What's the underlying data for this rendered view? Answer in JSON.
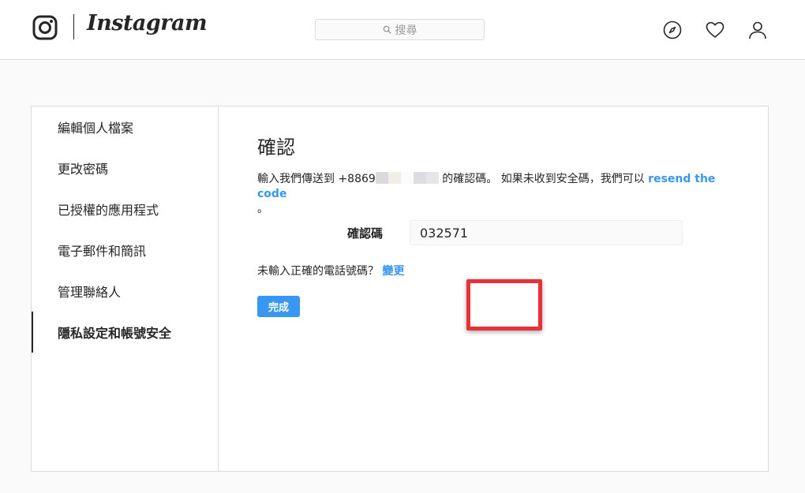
{
  "header": {
    "brand": "Instagram",
    "search_placeholder": "搜尋"
  },
  "sidebar": {
    "items": [
      {
        "label": "編輯個人檔案"
      },
      {
        "label": "更改密碼"
      },
      {
        "label": "已授權的應用程式"
      },
      {
        "label": "電子郵件和簡訊"
      },
      {
        "label": "管理聯絡人"
      },
      {
        "label": "隱私設定和帳號安全",
        "active": true
      }
    ]
  },
  "main": {
    "title": "確認",
    "info_prefix": "輸入我們傳送到 +8869",
    "info_middle": " 的確認碼。 如果未收到安全碼，我們可以 ",
    "resend_link": "resend the code",
    "info_suffix": "。",
    "code_label": "確認碼",
    "code_value": "032571",
    "wrong_number_text": "未輸入正確的電話號碼？ ",
    "change_link": "變更",
    "done_button": "完成"
  },
  "colors": {
    "accent": "#3897f0",
    "highlight": "#e8313b",
    "border": "#dbdbdb"
  }
}
